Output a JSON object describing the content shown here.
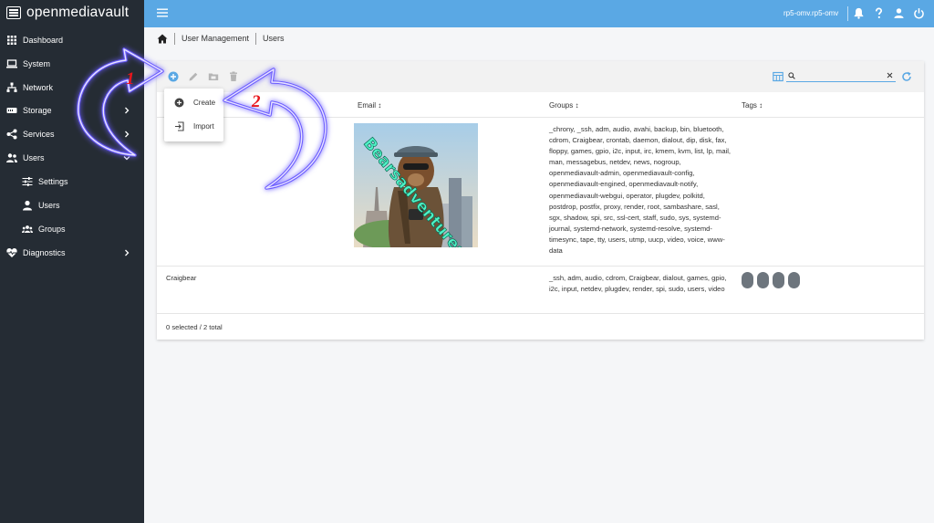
{
  "app": {
    "brand": "openmediavault",
    "host": "rp5-omv.rp5-omv"
  },
  "sidebar": {
    "items": [
      {
        "label": "Dashboard",
        "icon": "grid-icon"
      },
      {
        "label": "System",
        "icon": "laptop-icon"
      },
      {
        "label": "Network",
        "icon": "network-icon"
      },
      {
        "label": "Storage",
        "icon": "storage-icon"
      },
      {
        "label": "Services",
        "icon": "share-icon"
      },
      {
        "label": "Users",
        "icon": "users-icon"
      },
      {
        "label": "Settings",
        "icon": "sliders-icon"
      },
      {
        "label": "Users",
        "icon": "user-icon"
      },
      {
        "label": "Groups",
        "icon": "groups-icon"
      },
      {
        "label": "Diagnostics",
        "icon": "heartbeat-icon"
      }
    ]
  },
  "breadcrumb": {
    "section": "User Management",
    "page": "Users"
  },
  "toolbar": {
    "search_value": ""
  },
  "menu": {
    "create": "Create",
    "import": "Import"
  },
  "table": {
    "columns": {
      "email": "Email ↕",
      "groups": "Groups ↕",
      "tags": "Tags ↕"
    },
    "rows": [
      {
        "name": "",
        "groups": "_chrony, _ssh, adm, audio, avahi, backup, bin, bluetooth, cdrom, Craigbear, crontab, daemon, dialout, dip, disk, fax, floppy, games, gpio, i2c, input, irc, kmem, kvm, list, lp, mail, man, messagebus, netdev, news, nogroup, openmediavault-admin, openmediavault-config, openmediavault-engined, openmediavault-notify, openmediavault-webgui, operator, plugdev, polkitd, postdrop, postfix, proxy, render, root, sambashare, sasl, sgx, shadow, spi, src, ssl-cert, staff, sudo, sys, systemd-journal, systemd-network, systemd-resolve, systemd-timesync, tape, tty, users, utmp, uucp, video, voice, www-data"
      },
      {
        "name": "Craigbear",
        "groups": "_ssh, adm, audio, cdrom, Craigbear, dialout, games, gpio, i2c, input, netdev, plugdev, render, spi, sudo, users, video"
      }
    ],
    "footer": "0 selected / 2 total"
  },
  "image": {
    "watermark": "Bearsadventures"
  },
  "annotations": {
    "step1": "1",
    "step2": "2"
  },
  "colors": {
    "topbar": "#5aa8e4",
    "sidebar": "#252c34",
    "accent": "#5aa8e4",
    "annotation": "#e8161c"
  }
}
